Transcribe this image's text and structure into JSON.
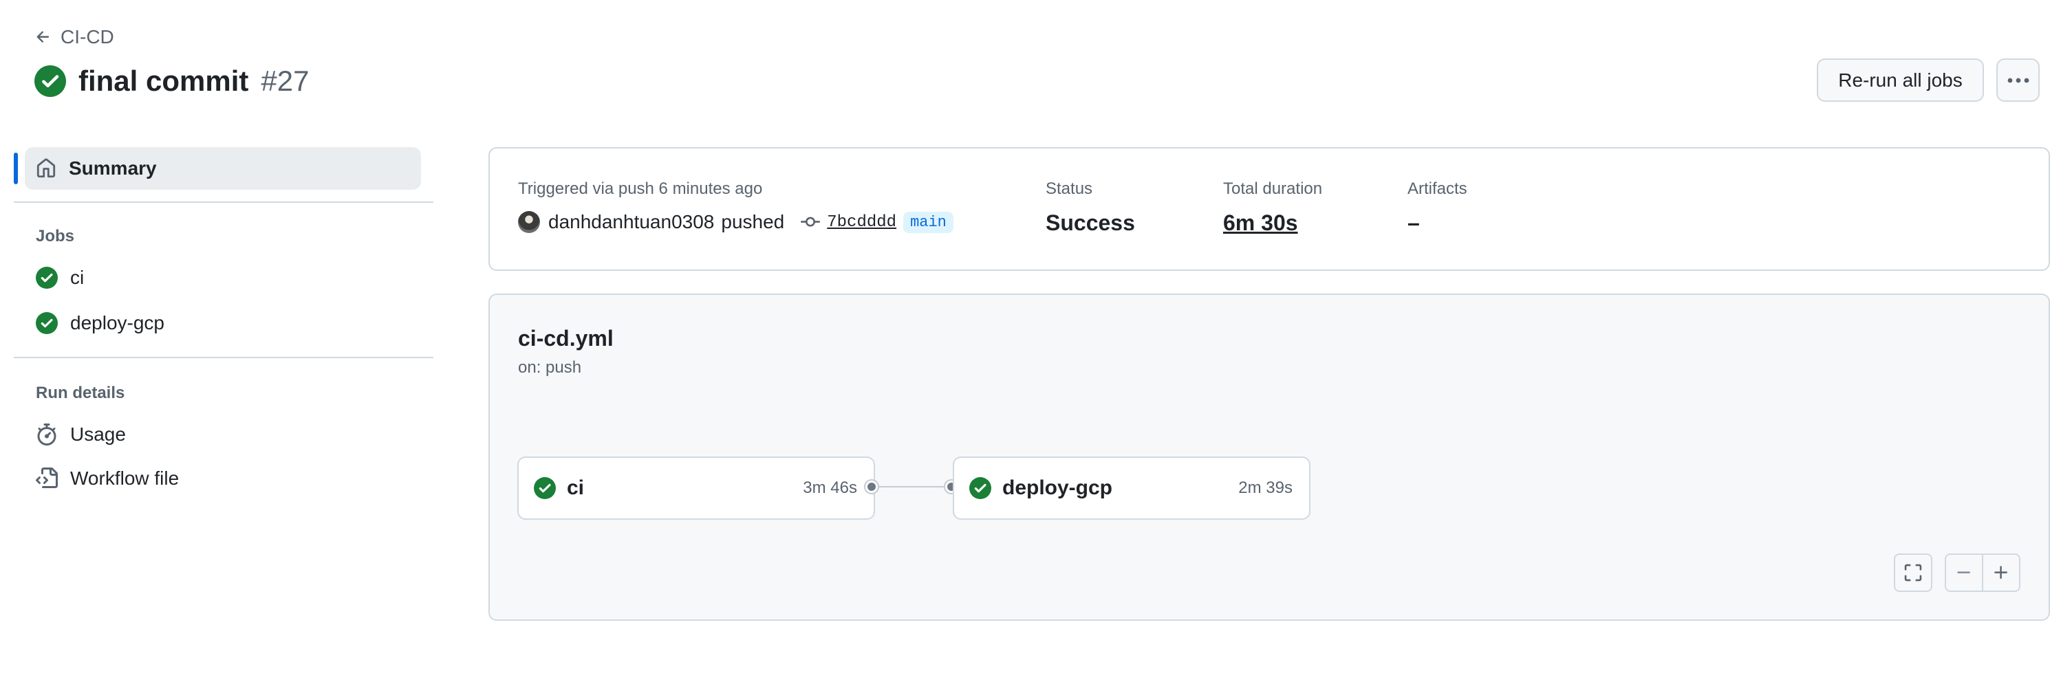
{
  "header": {
    "back_label": "CI-CD",
    "title": "final commit",
    "run_number": "#27",
    "rerun_label": "Re-run all jobs"
  },
  "sidebar": {
    "summary_label": "Summary",
    "jobs_heading": "Jobs",
    "jobs": [
      {
        "label": "ci",
        "status": "success"
      },
      {
        "label": "deploy-gcp",
        "status": "success"
      }
    ],
    "run_details_heading": "Run details",
    "run_details": [
      {
        "label": "Usage",
        "icon": "stopwatch-icon"
      },
      {
        "label": "Workflow file",
        "icon": "file-code-icon"
      }
    ]
  },
  "summary": {
    "trigger_text": "Triggered via push 6 minutes ago",
    "actor": "danhdanhtuan0308",
    "action": "pushed",
    "commit_sha": "7bcdddd",
    "branch": "main",
    "status_label": "Status",
    "status_value": "Success",
    "duration_label": "Total duration",
    "duration_value": "6m 30s",
    "artifacts_label": "Artifacts",
    "artifacts_value": "–"
  },
  "workflow": {
    "file": "ci-cd.yml",
    "trigger": "on: push",
    "jobs": [
      {
        "name": "ci",
        "duration": "3m 46s",
        "status": "success"
      },
      {
        "name": "deploy-gcp",
        "duration": "2m 39s",
        "status": "success"
      }
    ]
  },
  "colors": {
    "success": "#1a7f37",
    "accent": "#0969da",
    "border": "#d1d9e0",
    "muted_text": "#59636e"
  }
}
